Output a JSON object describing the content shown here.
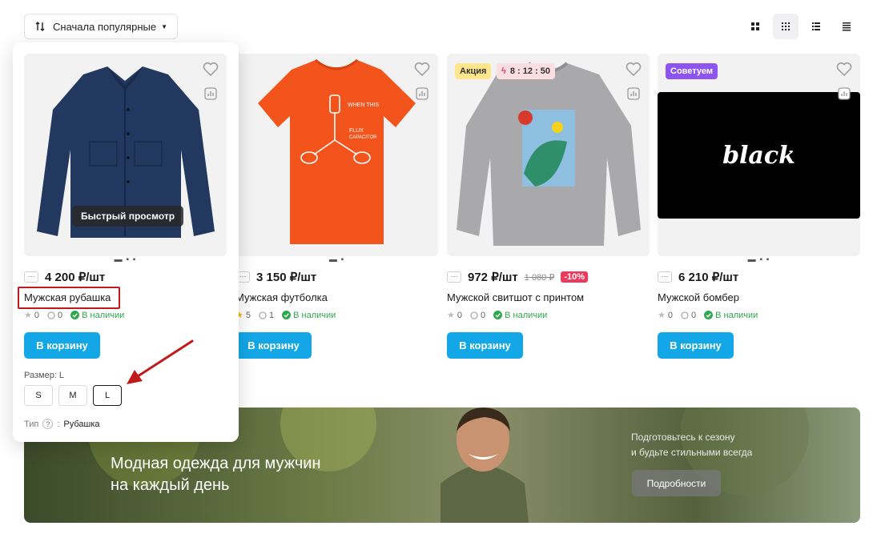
{
  "toolbar": {
    "sort_label": "Сначала популярные",
    "sort_icon": "sort-arrows-icon",
    "views": [
      "grid-large-icon",
      "grid-small-icon",
      "list-icon",
      "table-icon"
    ],
    "active_view": "grid-small-icon"
  },
  "quick_view_label": "Быстрый просмотр",
  "products": [
    {
      "name": "Мужская рубашка",
      "price": "4 200 ₽/шт",
      "rating": "0",
      "reviews": "0",
      "stock": "В наличии",
      "cart": "В корзину",
      "size_label": "Размер: L",
      "sizes": [
        "S",
        "M",
        "L"
      ],
      "selected_size": "L",
      "type_label": "Тип",
      "type_help": "?",
      "type_colon": ":",
      "type_value": "Рубашка"
    },
    {
      "name": "Мужская футболка",
      "price": "3 150 ₽/шт",
      "rating": "5",
      "reviews": "1",
      "stock": "В наличии",
      "cart": "В корзину"
    },
    {
      "name": "Мужской свитшот с принтом",
      "price": "972 ₽/шт",
      "old_price": "1 080 ₽",
      "discount": "-10%",
      "badge": "Акция",
      "timer": "8 : 12 : 50",
      "rating": "0",
      "reviews": "0",
      "stock": "В наличии",
      "cart": "В корзину"
    },
    {
      "name": "Мужской бомбер",
      "price": "6 210 ₽/шт",
      "badge": "Советуем",
      "image_text": "black",
      "rating": "0",
      "reviews": "0",
      "stock": "В наличии",
      "cart": "В корзину"
    }
  ],
  "banner": {
    "title_line1": "Модная одежда для мужчин",
    "title_line2": "на каждый день",
    "sub_line1": "Подготовьтесь к сезону",
    "sub_line2": "и будьте стильными всегда",
    "button": "Подробности"
  },
  "colors": {
    "accent": "#14a7e8",
    "in_stock": "#2fa84f",
    "discount": "#ec3a5e",
    "badge_sale": "#ffe58c",
    "badge_recommend": "#8e54f0",
    "highlight": "#c01a1a"
  }
}
